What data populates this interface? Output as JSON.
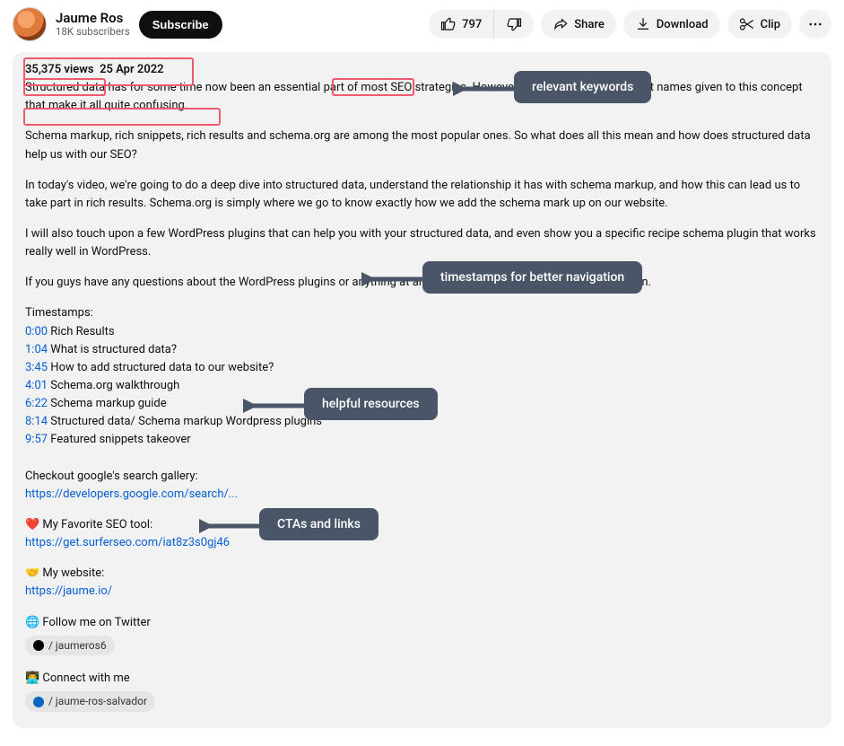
{
  "channel": {
    "name": "Jaume Ros",
    "subs": "18K subscribers",
    "subscribe_label": "Subscribe"
  },
  "actions": {
    "likes": "797",
    "share": "Share",
    "download": "Download",
    "clip": "Clip"
  },
  "meta": {
    "views": "35,375 views",
    "date": "25 Apr 2022"
  },
  "para": {
    "p1a": "Structured data",
    "p1b": " has for some time now been an essential part of most ",
    "p1c": "SEO strategies.",
    "p1d": " However, there are a lot of different names given to this concept that make it all quite confusing.",
    "p2a": "Schema markup, rich snippets, rich results",
    "p2b": " and schema.org are among the most popular ones. So what does all this mean and how does structured data help us with our SEO?",
    "p3": "In today's video, we're going to do a deep dive into structured data, understand the relationship it has with schema markup, and how this can lead us to take part in rich results. Schema.org is simply where we go to know exactly how we add the schema mark up on our website.",
    "p4": "I will also touch upon a few WordPress plugins that can help you with your structured data, and even show you a specific recipe schema plugin that works really well in WordPress.",
    "p5": "If you guys have any questions about the WordPress plugins or anything at all, please leave them in the comment section."
  },
  "timestamps_heading": "Timestamps:",
  "timestamps": [
    {
      "t": "0:00",
      "label": "Rich Results"
    },
    {
      "t": "1:04",
      "label": "What is structured data?"
    },
    {
      "t": "3:45",
      "label": "How to add structured data to our website?"
    },
    {
      "t": "4:01",
      "label": "Schema.org walkthrough"
    },
    {
      "t": "6:22",
      "label": "Schema markup guide"
    },
    {
      "t": "8:14",
      "label": "Structured data/ Schema markup Wordpress plugins"
    },
    {
      "t": "9:57",
      "label": "Featured snippets takeover"
    }
  ],
  "resources": {
    "google_label": "Checkout google's search gallery:",
    "google_link": "https://developers.google.com/search/...",
    "fav_label": "❤️ My Favorite SEO tool:",
    "fav_link": "https://get.surferseo.com/iat8z3s0gj46",
    "site_label": "🤝 My website:",
    "site_link": "https://jaume.io/"
  },
  "socials": {
    "twitter_label": "🌐 Follow me on Twitter",
    "twitter_handle": "/ jaumeros6",
    "linkedin_label": "👨‍💻 Connect with me",
    "linkedin_handle": "/ jaume-ros-salvador"
  },
  "annotations": {
    "keywords": "relevant keywords",
    "timestamps": "timestamps for better navigation",
    "resources": "helpful resources",
    "ctas": "CTAs and links"
  }
}
